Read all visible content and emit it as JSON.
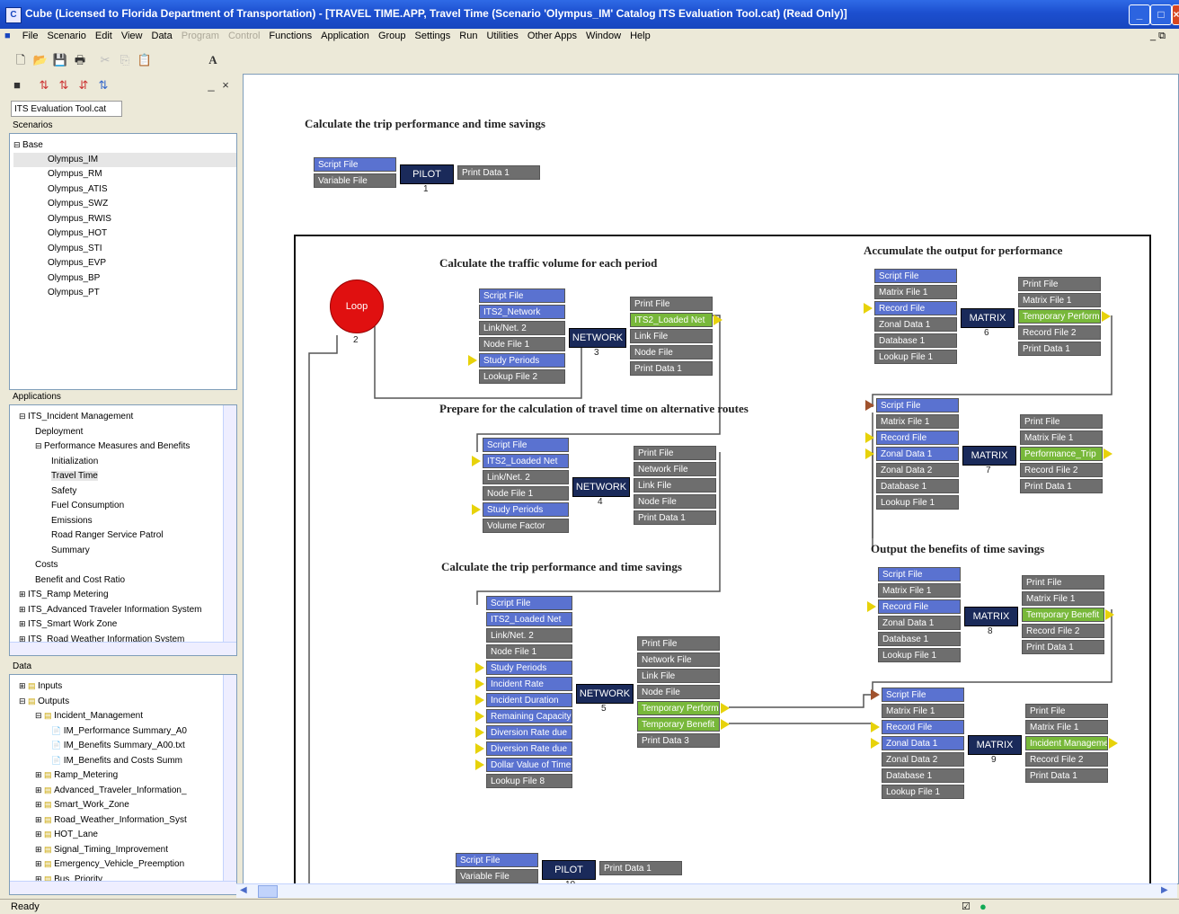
{
  "window": {
    "title": "Cube (Licensed to Florida Department of Transportation) - [TRAVEL TIME.APP, Travel Time (Scenario 'Olympus_IM' Catalog ITS Evaluation Tool.cat) (Read Only)]"
  },
  "menu": [
    "File",
    "Scenario",
    "Edit",
    "View",
    "Data",
    "Program",
    "Control",
    "Functions",
    "Application",
    "Group",
    "Settings",
    "Run",
    "Utilities",
    "Other Apps",
    "Window",
    "Help"
  ],
  "menu_disabled": [
    "Program",
    "Control"
  ],
  "catalog": {
    "tab": "ITS Evaluation Tool.cat",
    "scenarios_header": "Scenarios",
    "scenarios_root": "Base",
    "scenarios": [
      "Olympus_IM",
      "Olympus_RM",
      "Olympus_ATIS",
      "Olympus_SWZ",
      "Olympus_RWIS",
      "Olympus_HOT",
      "Olympus_STI",
      "Olympus_EVP",
      "Olympus_BP",
      "Olympus_PT"
    ],
    "applications_header": "Applications",
    "applications": [
      "ITS_Incident Management",
      "Deployment",
      "Performance Measures and Benefits",
      "Initialization",
      "Travel Time",
      "Safety",
      "Fuel Consumption",
      "Emissions",
      "Road Ranger Service Patrol",
      "Summary",
      "Costs",
      "Benefit and Cost Ratio",
      "ITS_Ramp Metering",
      "ITS_Advanced Traveler Information System",
      "ITS_Smart Work Zone",
      "ITS_Road Weather Information System"
    ],
    "data_header": "Data",
    "data": [
      "Inputs",
      "Outputs",
      "Incident_Management",
      "IM_Performance Summary_A0",
      "IM_Benefits Summary_A00.txt",
      "IM_Benefits and Costs Summ",
      "Ramp_Metering",
      "Advanced_Traveler_Information_",
      "Smart_Work_Zone",
      "Road_Weather_Information_Syst",
      "HOT_Lane",
      "Signal_Timing_Improvement",
      "Emergency_Vehicle_Preemption",
      "Bus_Priority"
    ]
  },
  "canvas": {
    "top_title": "Calculate the trip performance and time savings",
    "sec_traffic": "Calculate the traffic volume for each period",
    "sec_prepare": "Prepare for the calculation of travel time on alternative routes",
    "sec_trip": "Calculate the trip performance and time savings",
    "sec_accumulate": "Accumulate the output for performance",
    "sec_output": "Output the benefits of time savings",
    "loop_label": "Loop",
    "loop_num": "2",
    "pilot_top": {
      "label": "PILOT",
      "num": "1",
      "inputs": [
        "Script File",
        "Variable File"
      ],
      "outputs": [
        "Print Data 1"
      ]
    },
    "pilot_bottom": {
      "label": "PILOT",
      "num": "10",
      "inputs": [
        "Script File",
        "Variable File"
      ],
      "outputs": [
        "Print Data 1"
      ]
    },
    "net3": {
      "label": "NETWORK",
      "num": "3",
      "inputs": [
        "Script File",
        "ITS2_Network",
        "Link/Net. 2",
        "Node File 1",
        "Study Periods",
        "Lookup File 2"
      ],
      "outputs": [
        "Print File",
        "ITS2_Loaded Net",
        "Link File",
        "Node File",
        "Print Data 1"
      ]
    },
    "net4": {
      "label": "NETWORK",
      "num": "4",
      "inputs": [
        "Script File",
        "ITS2_Loaded Net",
        "Link/Net. 2",
        "Node File 1",
        "Study Periods",
        "Volume Factor"
      ],
      "outputs": [
        "Print File",
        "Network File",
        "Link File",
        "Node File",
        "Print Data 1"
      ]
    },
    "net5": {
      "label": "NETWORK",
      "num": "5",
      "inputs": [
        "Script File",
        "ITS2_Loaded Net",
        "Link/Net. 2",
        "Node File 1",
        "Study Periods",
        "Incident Rate",
        "Incident Duration",
        "Remaining Capacity",
        "Diversion Rate due",
        "Diversion Rate due",
        "Dollar Value of Time",
        "Lookup File 8"
      ],
      "outputs": [
        "Print File",
        "Network File",
        "Link File",
        "Node File",
        "Temporary Perform",
        "Temporary Benefit",
        "Print Data 3"
      ]
    },
    "mat6": {
      "label": "MATRIX",
      "num": "6",
      "inputs": [
        "Script File",
        "Matrix File 1",
        "Record File",
        "Zonal Data 1",
        "Database 1",
        "Lookup File 1"
      ],
      "outputs": [
        "Print File",
        "Matrix File 1",
        "Temporary Perform",
        "Record File 2",
        "Print Data 1"
      ]
    },
    "mat7": {
      "label": "MATRIX",
      "num": "7",
      "inputs": [
        "Script File",
        "Matrix File 1",
        "Record File",
        "Zonal Data 1",
        "Zonal Data 2",
        "Database 1",
        "Lookup File 1"
      ],
      "outputs": [
        "Print File",
        "Matrix File 1",
        "Performance_Trip",
        "Record File 2",
        "Print Data 1"
      ]
    },
    "mat8": {
      "label": "MATRIX",
      "num": "8",
      "inputs": [
        "Script File",
        "Matrix File 1",
        "Record File",
        "Zonal Data 1",
        "Database 1",
        "Lookup File 1"
      ],
      "outputs": [
        "Print File",
        "Matrix File 1",
        "Temporary Benefit",
        "Record File 2",
        "Print Data 1"
      ]
    },
    "mat9": {
      "label": "MATRIX",
      "num": "9",
      "inputs": [
        "Script File",
        "Matrix File 1",
        "Record File",
        "Zonal Data 1",
        "Zonal Data 2",
        "Database 1",
        "Lookup File 1"
      ],
      "outputs": [
        "Print File",
        "Matrix File 1",
        "Incident Management",
        "Record File 2",
        "Print Data 1"
      ]
    }
  },
  "status": {
    "text": "Ready"
  }
}
